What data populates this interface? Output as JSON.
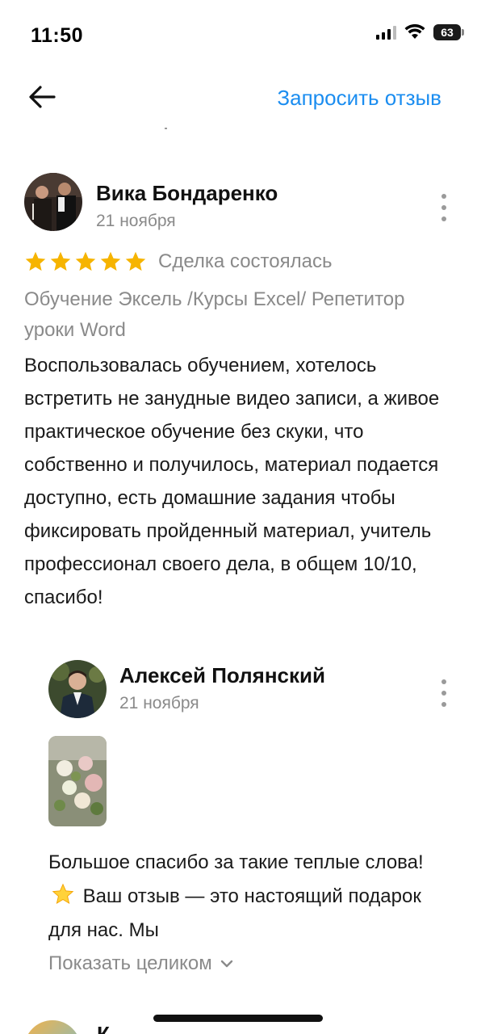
{
  "status_bar": {
    "time": "11:50",
    "battery": "63",
    "icons": [
      "signal-icon",
      "wifi-icon",
      "battery-icon"
    ]
  },
  "nav": {
    "back_icon": "arrow-left-icon",
    "request_review_label": "Запросить отзыв",
    "accent_color": "#1b8df0"
  },
  "review": {
    "author": "Вика Бондаренко",
    "date": "21 ноября",
    "rating": 5,
    "rating_max": 5,
    "star_color": "#f6b400",
    "deal_status": "Сделка состоялась",
    "service": "Обучение Эксель /Курсы Excel/ Репетитор уроки Word",
    "text": "Воспользовалась обучением, хотелось встретить не занудные видео записи, а живое практическое обучение без скуки, что собственно и получилось, материал подается доступно, есть домашние задания чтобы фиксировать пройденный материал, учитель профессионал своего дела, в общем 10/10, спасибо!"
  },
  "reply": {
    "author": "Алексей Полянский",
    "date": "21 ноября",
    "text_part1": "Большое спасибо за такие теплые слова!",
    "emoji": "star-emoji",
    "text_part2": "Ваш отзыв — это настоящий подарок для нас. Мы",
    "show_full_label": "Показать целиком"
  },
  "next_review": {
    "author_partial": "К"
  }
}
